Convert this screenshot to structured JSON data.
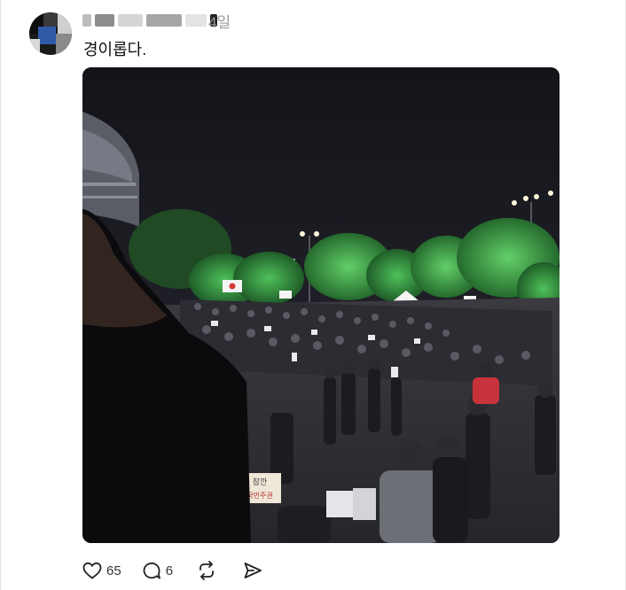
{
  "post": {
    "time": "4일",
    "text": "경이롭다.",
    "image_alt": "Night-time outdoor crowd gathering with Korean flags and signs",
    "sign_text_line1": "잠깐",
    "sign_text_line2": "국민주권"
  },
  "actions": {
    "like_count": "65",
    "comment_count": "6"
  },
  "icons": {
    "like": "heart-icon",
    "comment": "comment-bubble-icon",
    "repost": "repost-icon",
    "share": "send-icon"
  }
}
